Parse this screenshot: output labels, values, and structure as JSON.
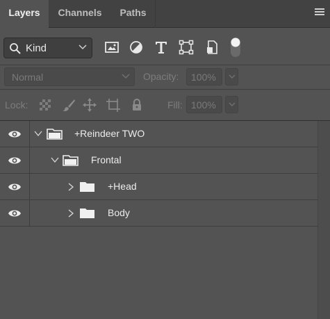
{
  "tabs": [
    {
      "label": "Layers",
      "active": true
    },
    {
      "label": "Channels",
      "active": false
    },
    {
      "label": "Paths",
      "active": false
    }
  ],
  "filter": {
    "kind_label": "Kind",
    "icons": [
      "image-filter-icon",
      "adjustment-filter-icon",
      "type-filter-icon",
      "shape-filter-icon",
      "smart-object-filter-icon",
      "filter-toggle-icon"
    ]
  },
  "blend": {
    "mode": "Normal",
    "opacity_label": "Opacity:",
    "opacity_value": "100%"
  },
  "lock": {
    "label": "Lock:",
    "icons": [
      "lock-transparent-pixels-icon",
      "lock-image-pixels-icon",
      "lock-position-icon",
      "lock-artboard-icon",
      "lock-all-icon"
    ],
    "fill_label": "Fill:",
    "fill_value": "100%"
  },
  "layers": [
    {
      "name": "+Reindeer TWO",
      "expanded": true,
      "depth": 0
    },
    {
      "name": "Frontal",
      "expanded": true,
      "depth": 1
    },
    {
      "name": "+Head",
      "expanded": false,
      "depth": 2
    },
    {
      "name": "Body",
      "expanded": false,
      "depth": 2
    }
  ],
  "colors": {
    "panel_bg": "#535353",
    "tabbar_bg": "#424242",
    "text": "#e6e6e6",
    "disabled_text": "#7a7a7a"
  }
}
